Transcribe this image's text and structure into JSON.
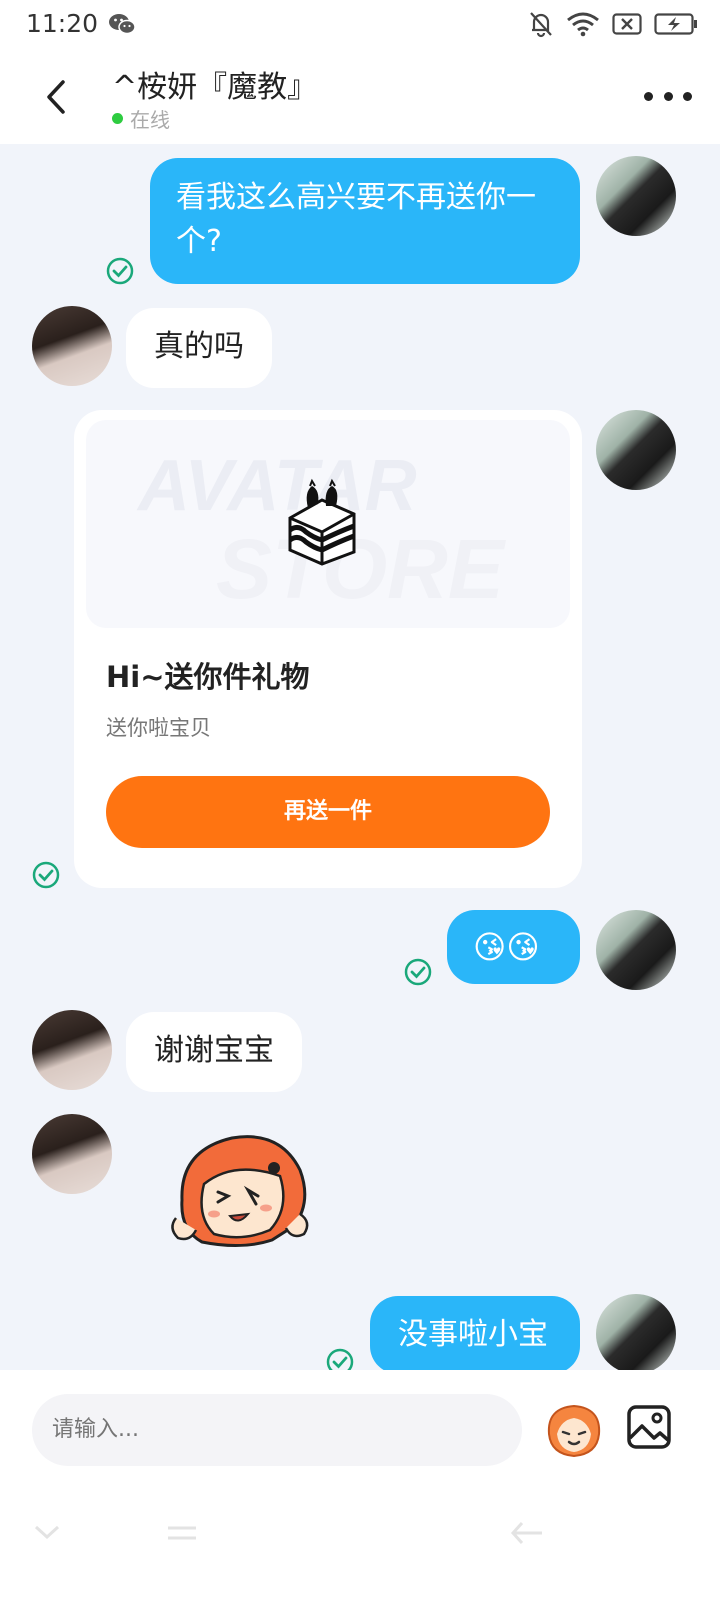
{
  "status_bar": {
    "time": "11:20",
    "icons": [
      "wechat-icon",
      "mute-bell-icon",
      "wifi-icon",
      "sim-off-icon",
      "battery-charging-icon"
    ]
  },
  "header": {
    "title": "^桉妍『魔教』",
    "status": "在线",
    "status_color": "#2ecc40"
  },
  "messages": [
    {
      "id": 1,
      "side": "me",
      "type": "text",
      "text": "看我这么高兴要不再送你一个?",
      "read": true
    },
    {
      "id": 2,
      "side": "her",
      "type": "text",
      "text": "真的吗"
    },
    {
      "id": 3,
      "side": "me",
      "type": "gift",
      "image_text": [
        "AVATAR",
        "STORE"
      ],
      "title": "Hi~送你件礼物",
      "subtitle": "送你啦宝贝",
      "button": "再送一件",
      "read": true
    },
    {
      "id": 4,
      "side": "me",
      "type": "text",
      "text": "😘😘",
      "read": true
    },
    {
      "id": 5,
      "side": "her",
      "type": "text",
      "text": "谢谢宝宝"
    },
    {
      "id": 6,
      "side": "her",
      "type": "sticker",
      "sticker": "cartoon-girl-sticker"
    },
    {
      "id": 7,
      "side": "me",
      "type": "text",
      "text": "没事啦小宝",
      "read": true
    }
  ],
  "input": {
    "placeholder": "请输入..."
  },
  "colors": {
    "bubble_out": "#2ab6f9",
    "bubble_in": "#ffffff",
    "gift_button": "#ff7411",
    "read_check": "#1aa87a",
    "background": "#f1f4fa"
  }
}
